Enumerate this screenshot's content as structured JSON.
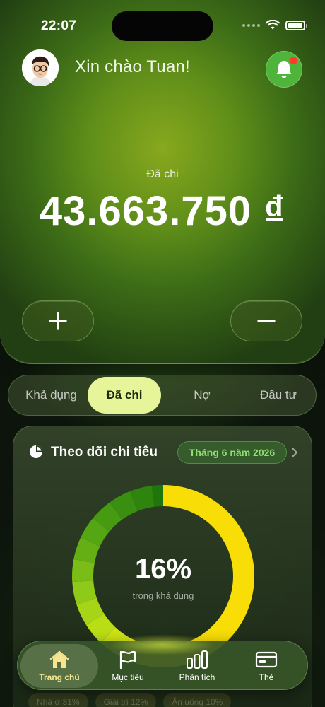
{
  "status_bar": {
    "time": "22:07"
  },
  "header": {
    "greeting": "Xin chào Tuan!"
  },
  "summary": {
    "label": "Đã chi",
    "amount": "43.663.750 ₫"
  },
  "actions": {
    "add": "+",
    "subtract": "−"
  },
  "tabs": [
    {
      "label": "Khả dụng",
      "selected": false
    },
    {
      "label": "Đã chi",
      "selected": true
    },
    {
      "label": "Nợ",
      "selected": false
    },
    {
      "label": "Đầu tư",
      "selected": false
    }
  ],
  "spending_card": {
    "title": "Theo dõi chi tiêu",
    "month": "Tháng 6 năm 2026",
    "percent": "16%",
    "percent_caption": "trong khả dụng",
    "chips": [
      "Nhà ở 31%",
      "Giải trí 12%",
      "Ăn uống 10%"
    ]
  },
  "chart_data": {
    "type": "pie",
    "values": [
      50,
      4,
      4,
      4,
      4,
      4,
      4,
      4,
      4,
      4,
      4,
      4,
      4,
      2
    ],
    "colors": [
      "#f8dd06",
      "#f1e30b",
      "#e0e40f",
      "#cfe413",
      "#bade16",
      "#a6d518",
      "#8fca18",
      "#7abd17",
      "#65af15",
      "#55a613",
      "#479b11",
      "#3b8f10",
      "#2f840e",
      "#1f770c"
    ]
  },
  "bottom_nav": [
    {
      "label": "Trang chủ",
      "icon": "home-icon",
      "active": true
    },
    {
      "label": "Mục tiêu",
      "icon": "flag-icon",
      "active": false
    },
    {
      "label": "Phân tích",
      "icon": "bar-chart-icon",
      "active": false
    },
    {
      "label": "Thẻ",
      "icon": "card-icon",
      "active": false
    }
  ],
  "colors": {
    "accent": "#e6f59a",
    "active_nav": "#f6e58e",
    "month_text": "#8ee06c",
    "bell": "#4fb53a",
    "notification_dot": "#ff3b30"
  }
}
